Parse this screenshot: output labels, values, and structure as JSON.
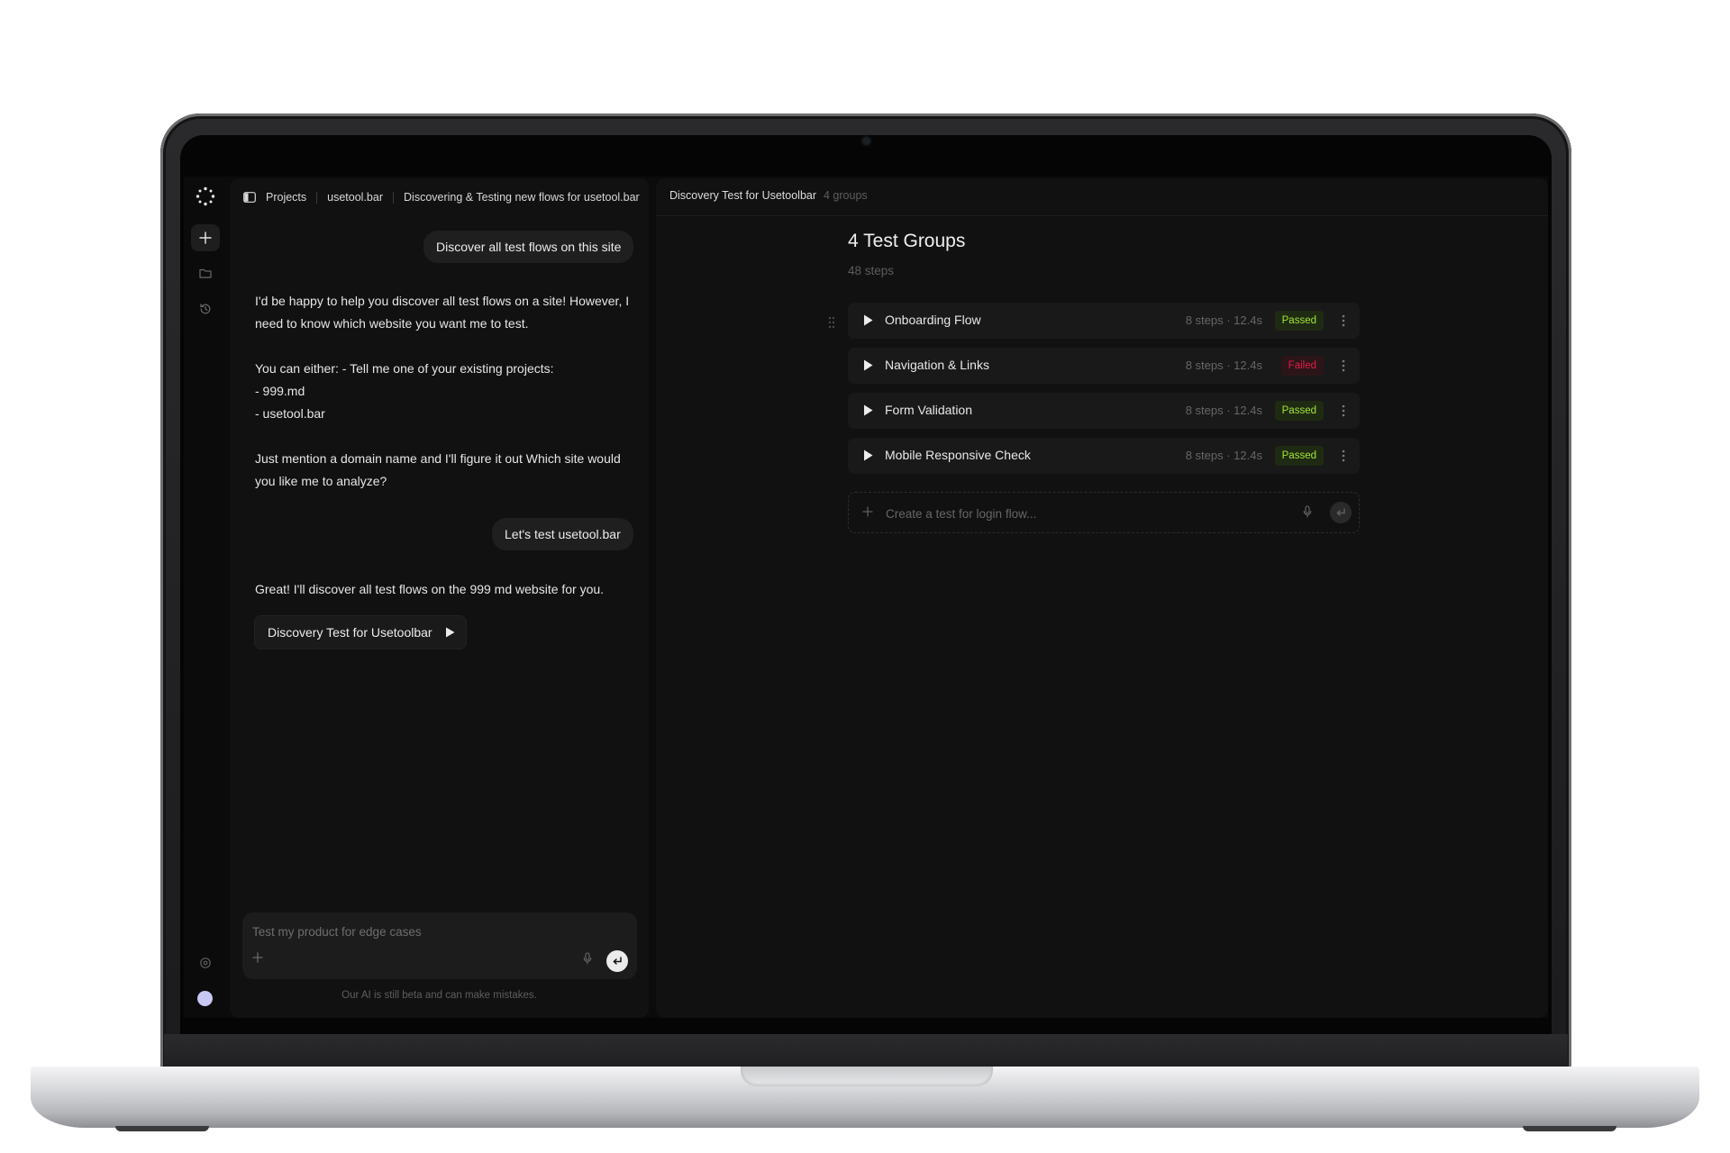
{
  "breadcrumb": [
    "Projects",
    "usetool.bar",
    "Discovering & Testing new flows for usetool.bar"
  ],
  "chat": {
    "messages": [
      {
        "role": "user",
        "text": "Discover all test flows on this site"
      },
      {
        "role": "assistant",
        "paragraphs": [
          "I'd be happy to help you discover all test flows on a site! However, I",
          "need to know which website you want me to test.",
          "",
          "You can either: - Tell me one of your existing projects:",
          "- 999.md",
          "- usetool.bar",
          "",
          "Just mention a domain name and I'll figure it out Which site would",
          "you like me to analyze?"
        ]
      },
      {
        "role": "user",
        "text": "Let's test usetool.bar"
      },
      {
        "role": "assistant",
        "text": "Great! I'll discover all test flows on the 999 md website for you."
      }
    ],
    "discovery_chip": "Discovery Test for Usetoolbar",
    "composer_placeholder": "Test my product for edge cases",
    "disclaimer": "Our AI is still beta and can make mistakes."
  },
  "main": {
    "title": "Discovery Test for Usetoolbar",
    "groups_count": "4 groups",
    "heading": "4 Test Groups",
    "steps_total": "48 steps",
    "groups": [
      {
        "name": "Onboarding Flow",
        "meta": "8 steps · 12.4s",
        "status": "Passed"
      },
      {
        "name": "Navigation & Links",
        "meta": "8 steps · 12.4s",
        "status": "Failed"
      },
      {
        "name": "Form Validation",
        "meta": "8 steps · 12.4s",
        "status": "Passed"
      },
      {
        "name": "Mobile Responsive Check",
        "meta": "8 steps · 12.4s",
        "status": "Passed"
      }
    ],
    "create_placeholder": "Create a test for login flow..."
  },
  "icons": {
    "logo": "dots-logo-icon",
    "new": "plus-icon",
    "folder": "folder-icon",
    "history": "history-icon",
    "settings": "settings-icon",
    "mic": "mic-icon",
    "send": "enter-icon",
    "play": "play-icon",
    "kebab": "kebab-icon"
  },
  "colors": {
    "passed": "#a3e635",
    "failed": "#e11d48",
    "avatar": "#c9c7f3"
  }
}
